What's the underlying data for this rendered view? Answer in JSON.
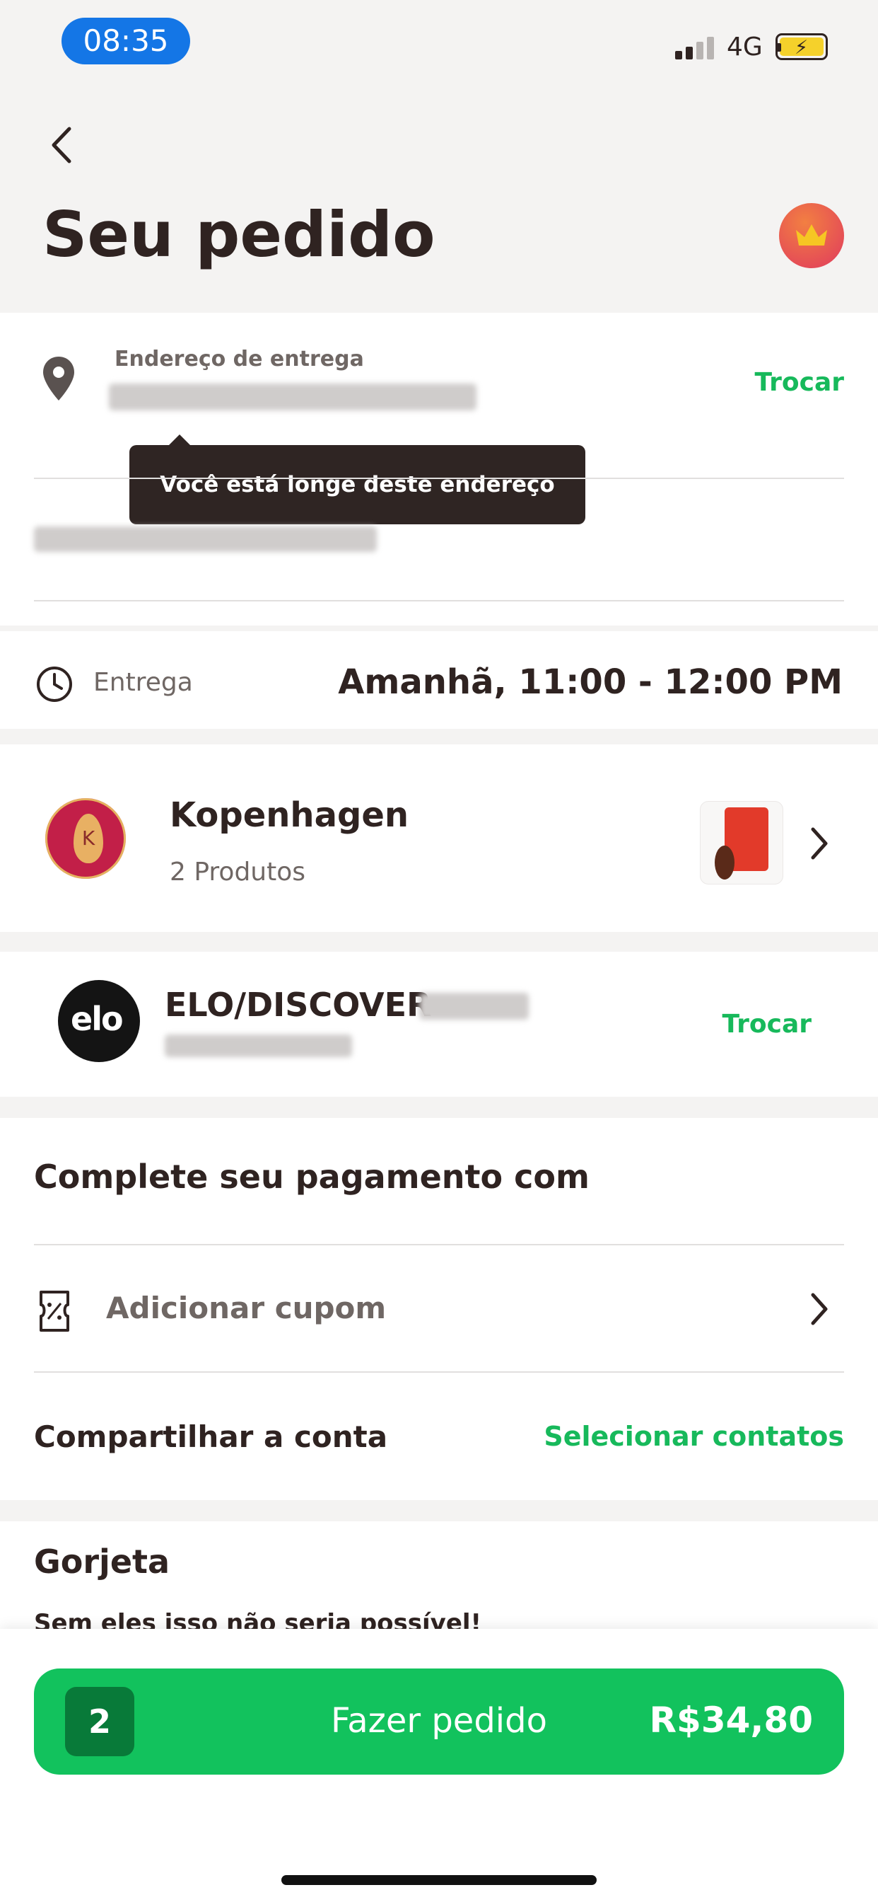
{
  "status_bar": {
    "time": "08:35",
    "network": "4G"
  },
  "header": {
    "title": "Seu pedido",
    "avatar_icon": "crown-icon"
  },
  "address": {
    "label": "Endereço de entrega",
    "change_label": "Trocar",
    "tooltip": "Você está longe deste endereço"
  },
  "delivery": {
    "label": "Entrega",
    "time": "Amanhã, 11:00 - 12:00 PM"
  },
  "store": {
    "name": "Kopenhagen",
    "items": "2 Produtos"
  },
  "payment": {
    "method": "ELO/DISCOVER",
    "change_label": "Trocar"
  },
  "complete": {
    "title": "Complete seu pagamento com",
    "coupon_label": "Adicionar cupom",
    "share_label": "Compartilhar a conta",
    "share_action": "Selecionar contatos"
  },
  "tip": {
    "title": "Gorjeta",
    "subtitle": "Sem eles isso não seria possível!"
  },
  "footer": {
    "quantity": "2",
    "cta_label": "Fazer pedido",
    "price": "R$34,80"
  },
  "colors": {
    "accent": "#17b95b",
    "cta": "#12c25d",
    "dark": "#2f2321",
    "status_pill": "#1476e6"
  }
}
